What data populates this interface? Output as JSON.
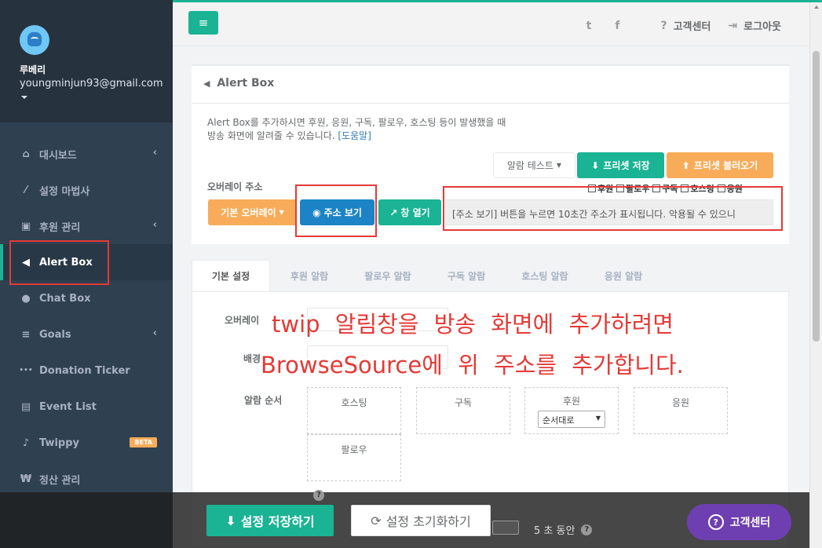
{
  "sidebar": {
    "profile": {
      "name": "루베리",
      "email": "youngminjun93@gmail.com"
    },
    "items": [
      {
        "label": "대시보드",
        "icon": "home-icon",
        "glyph": "⌂",
        "chevron": "‹"
      },
      {
        "label": "설정 마법사",
        "icon": "magic-wand-icon",
        "glyph": "⁄",
        "chevron": ""
      },
      {
        "label": "후원 관리",
        "icon": "gift-icon",
        "glyph": "▣",
        "chevron": "‹"
      },
      {
        "label": "Alert Box",
        "icon": "megaphone-icon",
        "glyph": "◀",
        "chevron": ""
      },
      {
        "label": "Chat Box",
        "icon": "chat-bubble-icon",
        "glyph": "●",
        "chevron": ""
      },
      {
        "label": "Goals",
        "icon": "list-icon",
        "glyph": "≡",
        "chevron": "‹"
      },
      {
        "label": "Donation Ticker",
        "icon": "ellipsis-icon",
        "glyph": "•••",
        "chevron": ""
      },
      {
        "label": "Event List",
        "icon": "newspaper-icon",
        "glyph": "▤",
        "chevron": ""
      },
      {
        "label": "Twippy",
        "icon": "bell-icon",
        "glyph": "♪",
        "chevron": "",
        "badge": "BETA"
      },
      {
        "label": "정산 관리",
        "icon": "won-icon",
        "glyph": "₩",
        "chevron": ""
      }
    ]
  },
  "navbar": {
    "menu_glyph": "≡",
    "twitter_glyph": "t",
    "facebook_glyph": "f",
    "support_label": "고객센터",
    "support_glyph": "?",
    "logout_label": "로그아웃",
    "logout_glyph": "⇥"
  },
  "alert_box": {
    "title": "Alert Box",
    "title_glyph": "◀",
    "desc_line1": "Alert Box를 추가하시면 후원, 응원, 구독, 팔로우, 호스팅 등이 발생했을 때",
    "desc_line2": "방송 화면에 알려줄 수 있습니다.",
    "help_link": "[도움말]",
    "test_button": "알람 테스트",
    "preset_save": "프리셋 저장",
    "preset_load": "프리셋 불러오기",
    "overlay_address_label": "오버레이 주소",
    "checks": [
      "후원",
      "팔로우",
      "구독",
      "호스팅",
      "응원"
    ],
    "overlay_button": "기본 오버레이",
    "show_address_button": "주소 보기",
    "open_window_button": "창 열기",
    "address_value": "[주소 보기] 버튼을 누르면 10초간 주소가 표시됩니다. 악용될 수 있으니"
  },
  "tabs": [
    "기본 설정",
    "후원 알람",
    "팔로우 알람",
    "구독 알람",
    "호스팅 알람",
    "응원 알람"
  ],
  "settings": {
    "overlay_label": "오버레이 ",
    "bg_label": "배경",
    "order_label": "알람 순서",
    "slots": [
      "호스팅",
      "구독",
      "후원",
      "응원",
      "팔로우"
    ],
    "donation_select": "순서대로"
  },
  "overlay_text": {
    "line1": "twip 알림창을 방송 화면에 추가하려면",
    "line2": "BrowseSource에 위 주소를 추가합니다."
  },
  "bottom": {
    "save_button": "설정 저장하기",
    "reset_button": "설정 초기화하기",
    "duration_text": "5 초 동안",
    "help_pill": "고객센터"
  },
  "colors": {
    "accent": "#1ab394",
    "orange": "#f8ac59",
    "blue": "#1c84c6",
    "sidebar": "#2f4050",
    "annotation_red": "#e53935",
    "help_purple": "#6e3fb0"
  }
}
